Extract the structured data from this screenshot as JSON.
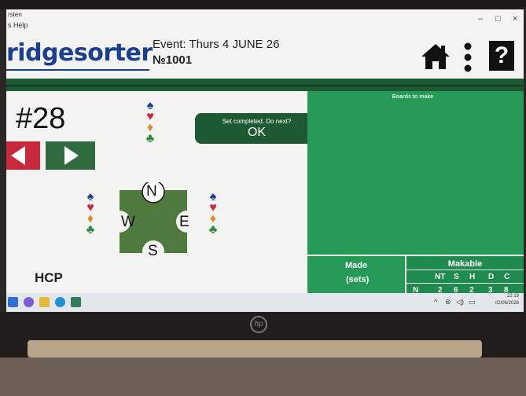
{
  "window": {
    "title_fragment": "rsten",
    "menu_fragment": "s Help",
    "controls": {
      "minimize": "–",
      "maximize": "□",
      "close": "×"
    }
  },
  "header": {
    "logo_text": "ridgesorter",
    "event_text": "Event: Thurs 4 JUNE 26",
    "event_number": "№1001",
    "icons": [
      "home-icon",
      "more-vertical-icon",
      "help-icon"
    ],
    "help_label": "?"
  },
  "board": {
    "number": "#28",
    "prev_icon": "arrow-left-icon",
    "next_icon": "arrow-right-icon"
  },
  "compass": {
    "north": "N",
    "south": "S",
    "east": "E",
    "west": "W"
  },
  "suits": {
    "spade": "♠",
    "heart": "♥",
    "diamond": "♦",
    "club": "♣"
  },
  "hcp_label": "HCP",
  "toast": {
    "message": "Set completed. Do next?",
    "ok_label": "OK"
  },
  "right_panel": {
    "title": "Boards to make"
  },
  "made_panel": {
    "line1": "Made",
    "line2": "(sets)"
  },
  "makable_panel": {
    "title": "Makable",
    "columns": [
      "NT",
      "S",
      "H",
      "D",
      "C"
    ],
    "row_label": "N",
    "row_values": [
      "2",
      "6",
      "2",
      "3",
      "8"
    ]
  },
  "taskbar": {
    "time": "22:19",
    "date": "02/06/2026"
  },
  "colors": {
    "accent_green": "#259a57",
    "dark_green": "#1d5a33",
    "logo_blue": "#1b3f8f",
    "spade": "#1b3f8f",
    "heart": "#c8283c",
    "diamond": "#e08a1e",
    "club": "#2e8b3a"
  }
}
